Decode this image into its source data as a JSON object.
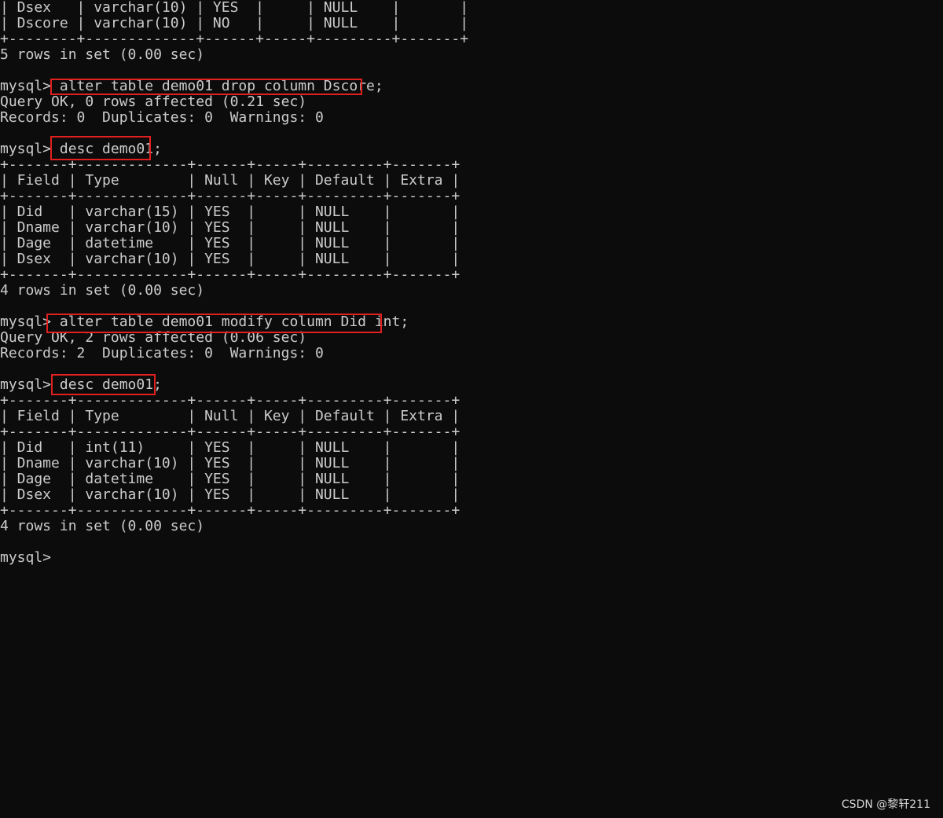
{
  "terminal": {
    "lines": [
      "| Dsex   | varchar(10) | YES  |     | NULL    |       |",
      "| Dscore | varchar(10) | NO   |     | NULL    |       |",
      "+--------+-------------+------+-----+---------+-------+",
      "5 rows in set (0.00 sec)",
      "",
      "mysql> alter table demo01 drop column Dscore;",
      "Query OK, 0 rows affected (0.21 sec)",
      "Records: 0  Duplicates: 0  Warnings: 0",
      "",
      "mysql> desc demo01;",
      "+-------+-------------+------+-----+---------+-------+",
      "| Field | Type        | Null | Key | Default | Extra |",
      "+-------+-------------+------+-----+---------+-------+",
      "| Did   | varchar(15) | YES  |     | NULL    |       |",
      "| Dname | varchar(10) | YES  |     | NULL    |       |",
      "| Dage  | datetime    | YES  |     | NULL    |       |",
      "| Dsex  | varchar(10) | YES  |     | NULL    |       |",
      "+-------+-------------+------+-----+---------+-------+",
      "4 rows in set (0.00 sec)",
      "",
      "mysql> alter table demo01 modify column Did int;",
      "Query OK, 2 rows affected (0.06 sec)",
      "Records: 2  Duplicates: 0  Warnings: 0",
      "",
      "mysql> desc demo01;",
      "+-------+-------------+------+-----+---------+-------+",
      "| Field | Type        | Null | Key | Default | Extra |",
      "+-------+-------------+------+-----+---------+-------+",
      "| Did   | int(11)     | YES  |     | NULL    |       |",
      "| Dname | varchar(10) | YES  |     | NULL    |       |",
      "| Dage  | datetime    | YES  |     | NULL    |       |",
      "| Dsex  | varchar(10) | YES  |     | NULL    |       |",
      "+-------+-------------+------+-----+---------+-------+",
      "4 rows in set (0.00 sec)",
      "",
      "mysql> "
    ]
  },
  "watermark": "CSDN @黎轩211",
  "colors": {
    "background": "#0c0c0c",
    "text": "#cccccc",
    "highlight": "#e0201e"
  }
}
